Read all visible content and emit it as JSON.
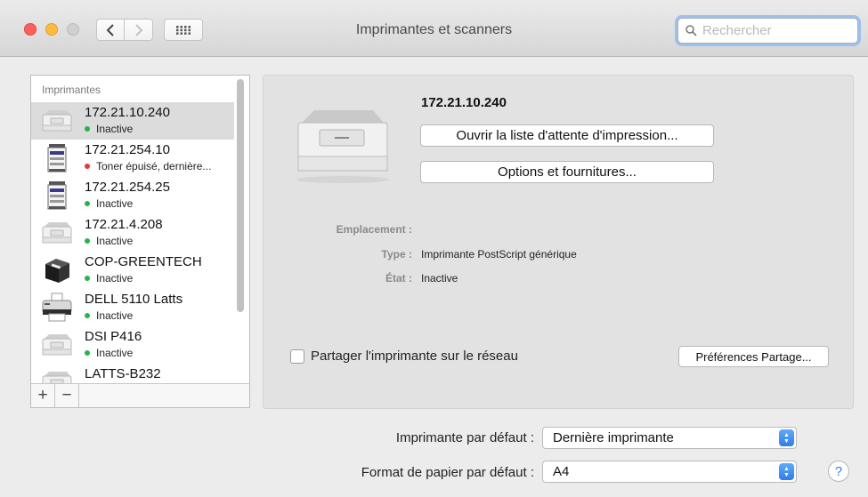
{
  "window": {
    "title": "Imprimantes et scanners"
  },
  "toolbar": {
    "back_icon": "chevron-left-icon",
    "forward_icon": "chevron-right-icon",
    "grid_icon": "grid-icon"
  },
  "search": {
    "placeholder": "Rechercher",
    "value": ""
  },
  "printer_list": {
    "header": "Imprimantes",
    "items": [
      {
        "name": "172.21.10.240",
        "status": "Inactive",
        "status_color": "#2bb24c",
        "icon": "laser-printer-icon",
        "selected": true
      },
      {
        "name": "172.21.254.10",
        "status": "Toner épuisé, dernière...",
        "status_color": "#e53935",
        "icon": "copier-icon",
        "selected": false
      },
      {
        "name": "172.21.254.25",
        "status": "Inactive",
        "status_color": "#2bb24c",
        "icon": "copier-icon",
        "selected": false
      },
      {
        "name": "172.21.4.208",
        "status": "Inactive",
        "status_color": "#2bb24c",
        "icon": "laser-printer-icon",
        "selected": false
      },
      {
        "name": "COP-GREENTECH",
        "status": "Inactive",
        "status_color": "#2bb24c",
        "icon": "black-printer-icon",
        "selected": false
      },
      {
        "name": "DELL 5110 Latts",
        "status": "Inactive",
        "status_color": "#2bb24c",
        "icon": "inkjet-printer-icon",
        "selected": false
      },
      {
        "name": "DSI P416",
        "status": "Inactive",
        "status_color": "#2bb24c",
        "icon": "laser-printer-icon",
        "selected": false
      },
      {
        "name": "LATTS-B232",
        "status": "",
        "status_color": "#2bb24c",
        "icon": "laser-printer-icon",
        "selected": false
      }
    ],
    "add_label": "+",
    "remove_label": "−"
  },
  "details": {
    "name": "172.21.10.240",
    "open_queue_label": "Ouvrir la liste d'attente d'impression...",
    "options_label": "Options et fournitures...",
    "location_label": "Emplacement :",
    "location_value": "",
    "type_label": "Type :",
    "type_value": "Imprimante PostScript générique",
    "state_label": "État :",
    "state_value": "Inactive",
    "share_label": "Partager l'imprimante sur le réseau",
    "share_checked": false,
    "share_prefs_label": "Préférences Partage..."
  },
  "defaults": {
    "printer_label": "Imprimante par défaut :",
    "printer_value": "Dernière imprimante",
    "paper_label": "Format de papier par défaut :",
    "paper_value": "A4"
  },
  "help": {
    "label": "?"
  }
}
